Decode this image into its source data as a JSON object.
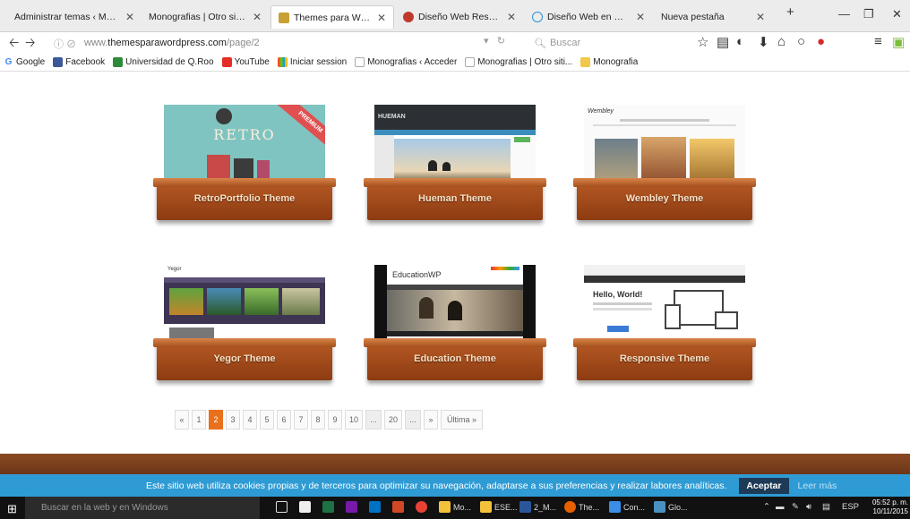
{
  "tabs": [
    {
      "title": "Administrar temas ‹ Mono...",
      "active": false
    },
    {
      "title": "Monografias | Otro sitio re...",
      "active": false
    },
    {
      "title": "Themes para Wordpre...",
      "active": true
    },
    {
      "title": "Diseño Web Responsiv...",
      "active": false
    },
    {
      "title": "Diseño Web en WordP...",
      "active": false
    },
    {
      "title": "Nueva pestaña",
      "active": false
    }
  ],
  "new_tab_label": "+",
  "url": {
    "prefix": "www.",
    "domain": "themesparawordpress.com",
    "path": "/page/2"
  },
  "search_placeholder": "Buscar",
  "bookmarks": [
    "Google",
    "Facebook",
    "Universidad de Q.Roo",
    "YouTube",
    "Iniciar session",
    "Monografias ‹ Acceder",
    "Monografias | Otro siti...",
    "Monografia"
  ],
  "themes": [
    {
      "name": "RetroPortfolio Theme",
      "banner": "RETRO",
      "ribbon": "PREMIUM"
    },
    {
      "name": "Hueman Theme",
      "banner": "HUEMAN"
    },
    {
      "name": "Wembley Theme",
      "banner": "Wembley"
    },
    {
      "name": "Yegor Theme",
      "banner": "Yegor"
    },
    {
      "name": "Education Theme",
      "banner": "EducationWP"
    },
    {
      "name": "Responsive Theme",
      "banner": "Hello, World!"
    }
  ],
  "pagination": {
    "prev": "«",
    "pages": [
      "1",
      "2",
      "3",
      "4",
      "5",
      "6",
      "7",
      "8",
      "9",
      "10"
    ],
    "current": "2",
    "gap": "...",
    "page20": "20",
    "next": "»",
    "last": "Última »"
  },
  "cookie": {
    "text": "Este sitio web utiliza cookies propias y de terceros para optimizar su navegación, adaptarse a sus preferencias y realizar labores analíticas.",
    "accept": "Aceptar",
    "more": "Leer más"
  },
  "taskbar": {
    "search": "Buscar en la web y en Windows",
    "apps": [
      "Mo...",
      "ESE...",
      "2_M...",
      "The...",
      "Con...",
      "Glo..."
    ],
    "lang": "ESP",
    "time": "05:52 p. m.",
    "date": "10/11/2015"
  }
}
